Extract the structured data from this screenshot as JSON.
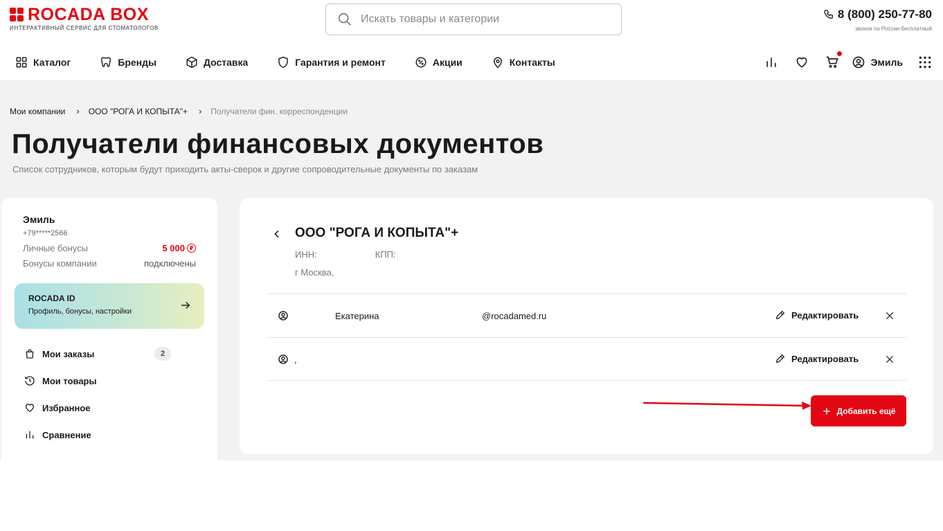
{
  "header": {
    "logo_text": "ROCADA BOX",
    "logo_subtitle": "ИНТЕРАКТИВНЫЙ СЕРВИС ДЛЯ СТОМАТОЛОГОВ",
    "search_placeholder": "Искать товары и категории",
    "phone": "8 (800) 250-77-80",
    "phone_note": "звонок по России бесплатный",
    "nav": [
      {
        "label": "Каталог",
        "icon": "grid-icon"
      },
      {
        "label": "Бренды",
        "icon": "tooth-icon"
      },
      {
        "label": "Доставка",
        "icon": "box-icon"
      },
      {
        "label": "Гарантия и ремонт",
        "icon": "shield-icon"
      },
      {
        "label": "Акции",
        "icon": "percent-badge-icon"
      },
      {
        "label": "Контакты",
        "icon": "location-pin-icon"
      }
    ],
    "user_name": "Эмиль",
    "cart_has_items": true
  },
  "breadcrumb": {
    "items": [
      "Мои компании",
      "ООО \"РОГА И КОПЫТА\"+"
    ],
    "current": "Получатели фин. корреспонденции"
  },
  "page": {
    "title": "Получатели финансовых документов",
    "subtitle": "Список сотрудников, которым будут приходить акты-сверок и другие сопроводительные документы по заказам"
  },
  "sidebar": {
    "name": "Эмиль",
    "phone": "+79*****2566",
    "personal_bonus_label": "Личные бонусы",
    "personal_bonus_value": "5 000",
    "company_bonus_label": "Бонусы компании",
    "company_bonus_value": "подключены",
    "rocada_id_title": "ROCADA ID",
    "rocada_id_sub": "Профиль, бонусы, настройки",
    "menu": [
      {
        "label": "Мои заказы",
        "icon": "bag-icon",
        "badge": "2"
      },
      {
        "label": "Мои товары",
        "icon": "history-icon"
      },
      {
        "label": "Избранное",
        "icon": "heart-icon"
      },
      {
        "label": "Сравнение",
        "icon": "compare-icon"
      }
    ]
  },
  "company": {
    "name": "ООО \"РОГА И КОПЫТА\"+",
    "inn_label": "ИНН:",
    "kpp_label": "КПП:",
    "address": "г Москва, "
  },
  "recipients": [
    {
      "name": "Екатерина",
      "email": "@rocadamed.ru",
      "edit_label": "Редактировать"
    },
    {
      "name": ",",
      "email": "",
      "edit_label": "Редактировать"
    }
  ],
  "add_button_label": "Добавить ещё",
  "colors": {
    "accent": "#e30613",
    "background": "#f2f2f2"
  }
}
